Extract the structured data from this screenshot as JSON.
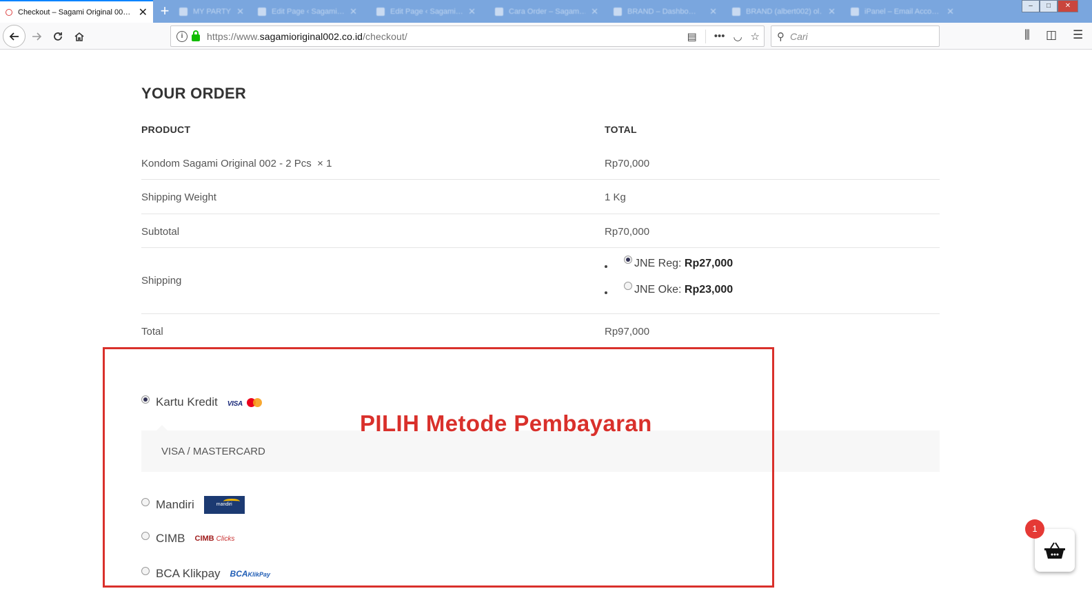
{
  "browser": {
    "tabs": [
      {
        "title": "Checkout – Sagami Original 00…",
        "active": true
      },
      {
        "title": "MY PARTY – Ev…",
        "active": false
      },
      {
        "title": "Edit Page ‹ Sagami…",
        "active": false
      },
      {
        "title": "Edit Page ‹ Sagami…",
        "active": false
      },
      {
        "title": "Cara Order – Sagam…",
        "active": false
      },
      {
        "title": "BRAND – Dashbo…",
        "active": false
      },
      {
        "title": "BRAND (albert002) ol…",
        "active": false
      },
      {
        "title": "iPanel – Email Acco…",
        "active": false
      }
    ],
    "new_tab_label": "+",
    "url": {
      "prefix": "https://www.",
      "domain": "sagamioriginal002.co.id",
      "path": "/checkout/"
    },
    "search_placeholder": "Cari",
    "window_controls": {
      "minimize": "–",
      "maximize": "□",
      "close": "✕"
    }
  },
  "order": {
    "heading": "YOUR ORDER",
    "col_product": "PRODUCT",
    "col_total": "TOTAL",
    "item": {
      "name": "Kondom Sagami Original 002 - 2 Pcs",
      "qty": "× 1",
      "price": "Rp70,000"
    },
    "weight": {
      "label": "Shipping Weight",
      "value": "1 Kg"
    },
    "subtotal": {
      "label": "Subtotal",
      "value": "Rp70,000"
    },
    "shipping": {
      "label": "Shipping",
      "options": [
        {
          "name": "JNE Reg:",
          "price": "Rp27,000",
          "selected": true
        },
        {
          "name": "JNE Oke:",
          "price": "Rp23,000",
          "selected": false
        }
      ]
    },
    "total": {
      "label": "Total",
      "value": "Rp97,000"
    }
  },
  "payment": {
    "methods": [
      {
        "label": "Kartu Kredit",
        "logo": "VISA",
        "selected": true
      },
      {
        "label": "Mandiri",
        "logo": "mandiri clickpay",
        "selected": false
      },
      {
        "label": "CIMB",
        "logo": "CIMB Clicks",
        "selected": false
      },
      {
        "label": "BCA Klikpay",
        "logo": "BCA KlikPay",
        "selected": false
      }
    ],
    "card_box_text": "VISA / MASTERCARD",
    "logos": {
      "mandiri": "mandiri",
      "cimb": "CIMB",
      "cimb_suffix": "Clicks",
      "bca": "BCA",
      "bca_suffix": "KlikPay"
    }
  },
  "annotation": {
    "text": "PILIH Metode Pembayaran",
    "color": "#d9302b"
  },
  "cart": {
    "count": "1"
  },
  "colors": {
    "accent": "#0a84ff",
    "tabstrip": "#7aa6de",
    "lock": "#12bc00"
  }
}
